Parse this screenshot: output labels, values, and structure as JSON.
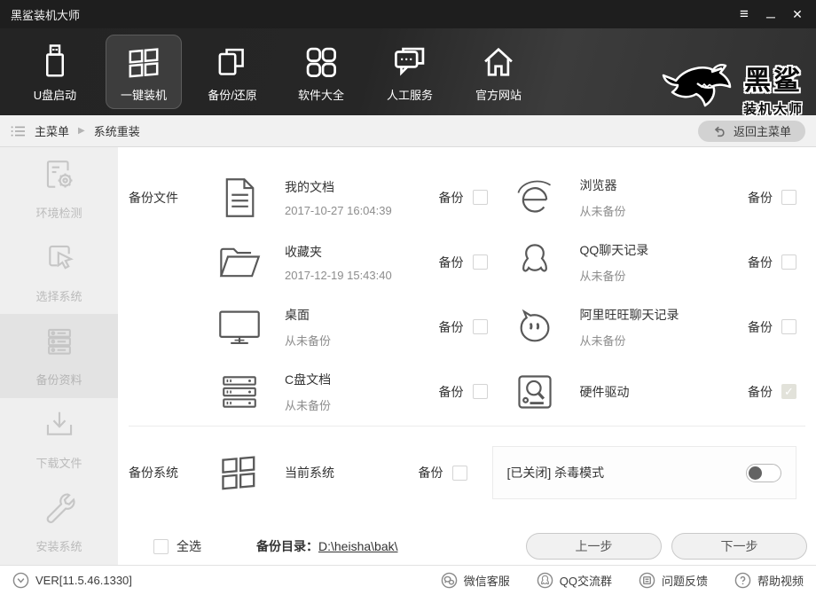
{
  "titlebar": {
    "title": "黑鲨装机大师",
    "menu_icon": "≡",
    "minimize_icon": "─",
    "close_icon": "✕"
  },
  "nav": {
    "items": [
      {
        "label": "U盘启动"
      },
      {
        "label": "一键装机"
      },
      {
        "label": "备份/还原"
      },
      {
        "label": "软件大全"
      },
      {
        "label": "人工服务"
      },
      {
        "label": "官方网站"
      }
    ],
    "logo_title": "黑鲨",
    "logo_subtitle": "装机大师"
  },
  "breadcrumb": {
    "root": "主菜单",
    "separator": "▶",
    "current": "系统重装",
    "back_button": "返回主菜单"
  },
  "sidebar": {
    "items": [
      {
        "label": "环境检测",
        "active": false
      },
      {
        "label": "选择系统",
        "active": false
      },
      {
        "label": "备份资料",
        "active": true
      },
      {
        "label": "下载文件",
        "active": false
      },
      {
        "label": "安装系统",
        "active": false
      }
    ]
  },
  "content": {
    "section_files_label": "备份文件",
    "section_system_label": "备份系统",
    "backup_label": "备份",
    "files": [
      {
        "name": "我的文档",
        "status": "2017-10-27 16:04:39",
        "checked": false
      },
      {
        "name": "浏览器",
        "status": "从未备份",
        "checked": false
      },
      {
        "name": "收藏夹",
        "status": "2017-12-19 15:43:40",
        "checked": false
      },
      {
        "name": "QQ聊天记录",
        "status": "从未备份",
        "checked": false
      },
      {
        "name": "桌面",
        "status": "从未备份",
        "checked": false
      },
      {
        "name": "阿里旺旺聊天记录",
        "status": "从未备份",
        "checked": false
      },
      {
        "name": "C盘文档",
        "status": "从未备份",
        "checked": false
      },
      {
        "name": "硬件驱动",
        "status": "",
        "checked": true
      }
    ],
    "system_item": {
      "name": "当前系统",
      "checked": false
    },
    "antivirus": {
      "label": "[已关闭] 杀毒模式",
      "enabled": false
    },
    "select_all_label": "全选",
    "select_all_checked": false,
    "backup_dir_label": "备份目录：",
    "backup_dir_path": "D:\\heisha\\bak\\",
    "prev_label": "上一步",
    "next_label": "下一步"
  },
  "footer": {
    "version": "VER[11.5.46.1330]",
    "links": [
      {
        "label": "微信客服"
      },
      {
        "label": "QQ交流群"
      },
      {
        "label": "问题反馈"
      },
      {
        "label": "帮助视频"
      }
    ]
  }
}
